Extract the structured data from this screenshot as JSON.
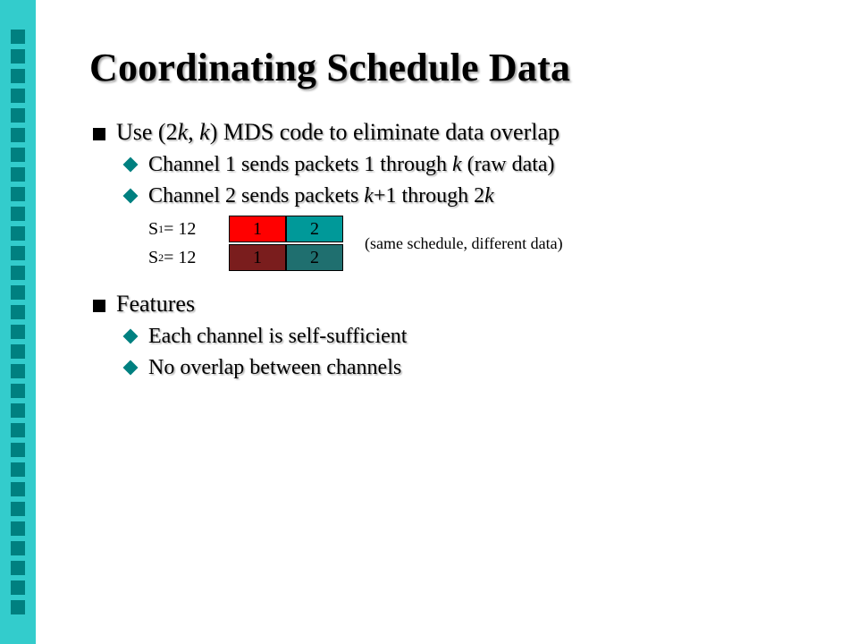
{
  "title": "Coordinating Schedule Data",
  "bullet1": {
    "text_a": "Use (2",
    "text_b": ", ",
    "text_c": ") MDS code to eliminate data overlap",
    "k": "k",
    "sub1_a": "Channel 1 sends packets 1 through ",
    "sub1_b": " (raw data)",
    "sub2_a": "Channel 2 sends packets ",
    "sub2_b": "+1 through 2"
  },
  "diagram": {
    "s1_label_a": "S",
    "s1_label_b": "1",
    "s1_label_c": " = 12",
    "s2_label_a": "S",
    "s2_label_b": "2",
    "s2_label_c": " = 12",
    "cell_11": "1",
    "cell_12": "2",
    "cell_21": "1",
    "cell_22": "2",
    "note": "(same schedule, different data)"
  },
  "bullet2": {
    "text": "Features",
    "sub1": "Each channel is self-sufficient",
    "sub2": "No overlap between channels"
  }
}
